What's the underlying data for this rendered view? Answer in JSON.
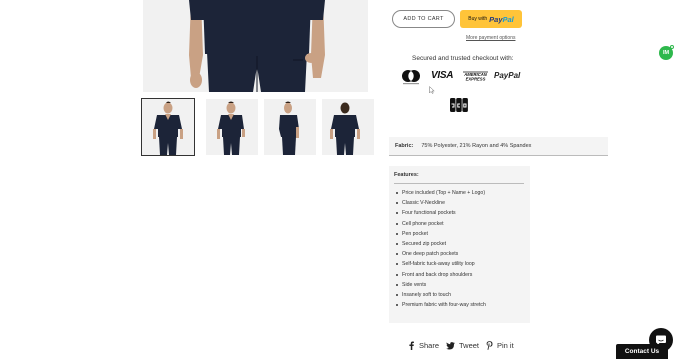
{
  "buttons": {
    "add_to_cart": "ADD TO CART",
    "paypal_buy": "Buy with",
    "paypal_word_1": "Pay",
    "paypal_word_2": "Pal",
    "more_payment": "More payment options"
  },
  "checkout": {
    "secured_text": "Secured and trusted checkout with:",
    "logos": [
      "mastercard-icon",
      "visa-icon",
      "amex-icon",
      "paypal-icon",
      "jcb-icon"
    ],
    "visa_text": "VISA",
    "paypal_text": "PayPal"
  },
  "fabric": {
    "label": "Fabric:",
    "value": "75% Polyester, 21% Rayon and 4% Spandex"
  },
  "features": {
    "title": "Features:",
    "items": [
      "Price included (Top + Name + Logo)",
      "Classic V-Neckline",
      "Four functional pockets",
      "Cell phone pocket",
      "Pen pocket",
      "Secured zip pocket",
      "One deep patch pockets",
      "Self-fabric tuck-away utility loop",
      "Front and back drop shoulders",
      "Side vents",
      "Insanely soft to touch",
      "Premium fabric with four-way stretch"
    ]
  },
  "share": {
    "share_label": "Share",
    "tweet_label": "Tweet",
    "pin_label": "Pin it"
  },
  "widgets": {
    "im_badge": "IM",
    "contact_us": "Contact Us"
  },
  "colors": {
    "scrub_navy": "#1c2438",
    "paypal_yellow": "#ffc439",
    "badge_green": "#2eb84c"
  }
}
